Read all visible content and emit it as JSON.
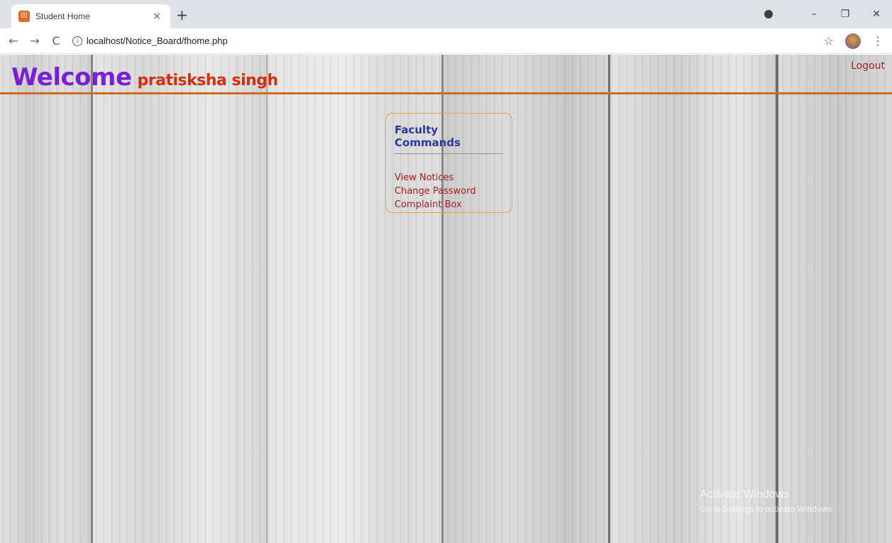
{
  "browser": {
    "tab_title": "Student Home",
    "tab_close": "×",
    "new_tab": "+",
    "url": "localhost/Notice_Board/fhome.php",
    "info_glyph": "i",
    "back_icon": "back-arrow-icon",
    "forward_icon": "forward-arrow-icon",
    "reload_icon": "reload-icon",
    "star_icon": "star-icon",
    "menu_icon": "kebab-menu-icon",
    "minimize": "–",
    "restore": "❐",
    "close": "✕"
  },
  "header": {
    "welcome": "Welcome",
    "username": "pratisksha singh",
    "logout": "Logout"
  },
  "commands": {
    "title": "Faculty Commands",
    "items": [
      "View Notices",
      "Change Password",
      "Complaint Box"
    ]
  },
  "watermark": {
    "title": "Activate Windows",
    "subtitle": "Go to Settings to activate Windows."
  },
  "colors": {
    "welcome": "#7a1fd6",
    "username": "#d2300e",
    "header_rule": "#d2691e",
    "commands_border": "#e3a53c",
    "commands_title": "#2a3a9c",
    "link": "#a51c1c"
  }
}
